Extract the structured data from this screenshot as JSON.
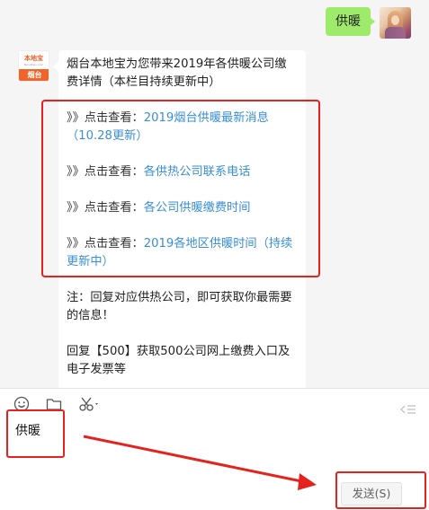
{
  "user_message": {
    "text": "供暖"
  },
  "bot_message": {
    "intro": "烟台本地宝为您带来2019年各供暖公司缴费详情（本栏目持续更新中）",
    "links": [
      {
        "prefix": "》》点击查看：",
        "label": "2019烟台供暖最新消息（10.28更新）"
      },
      {
        "prefix": "》》点击查看：",
        "label": "各供热公司联系电话"
      },
      {
        "prefix": "》》点击查看：",
        "label": "各公司供暖缴费时间"
      },
      {
        "prefix": "》》点击查看：",
        "label": "2019各地区供暖时间（持续更新中）"
      }
    ],
    "note": "注：回复对应供热公司，即可获取你最需要的信息！",
    "reply_hint": "回复【500】获取500公司网上缴费入口及电子发票等",
    "avatar_logo_text": "本地宝",
    "avatar_logo_sub": "Bendibao.com",
    "avatar_city": "烟台"
  },
  "composer": {
    "input_value": "供暖",
    "send_label": "发送(S)"
  },
  "icons": {
    "emoji": "emoji-icon",
    "folder": "folder-icon",
    "scissors": "scissors-icon",
    "collapse": "collapse-icon"
  },
  "colors": {
    "user_bubble": "#9eea6a",
    "link": "#3a8fd6",
    "highlight": "#e5221d",
    "brand_orange": "#f0642a"
  }
}
